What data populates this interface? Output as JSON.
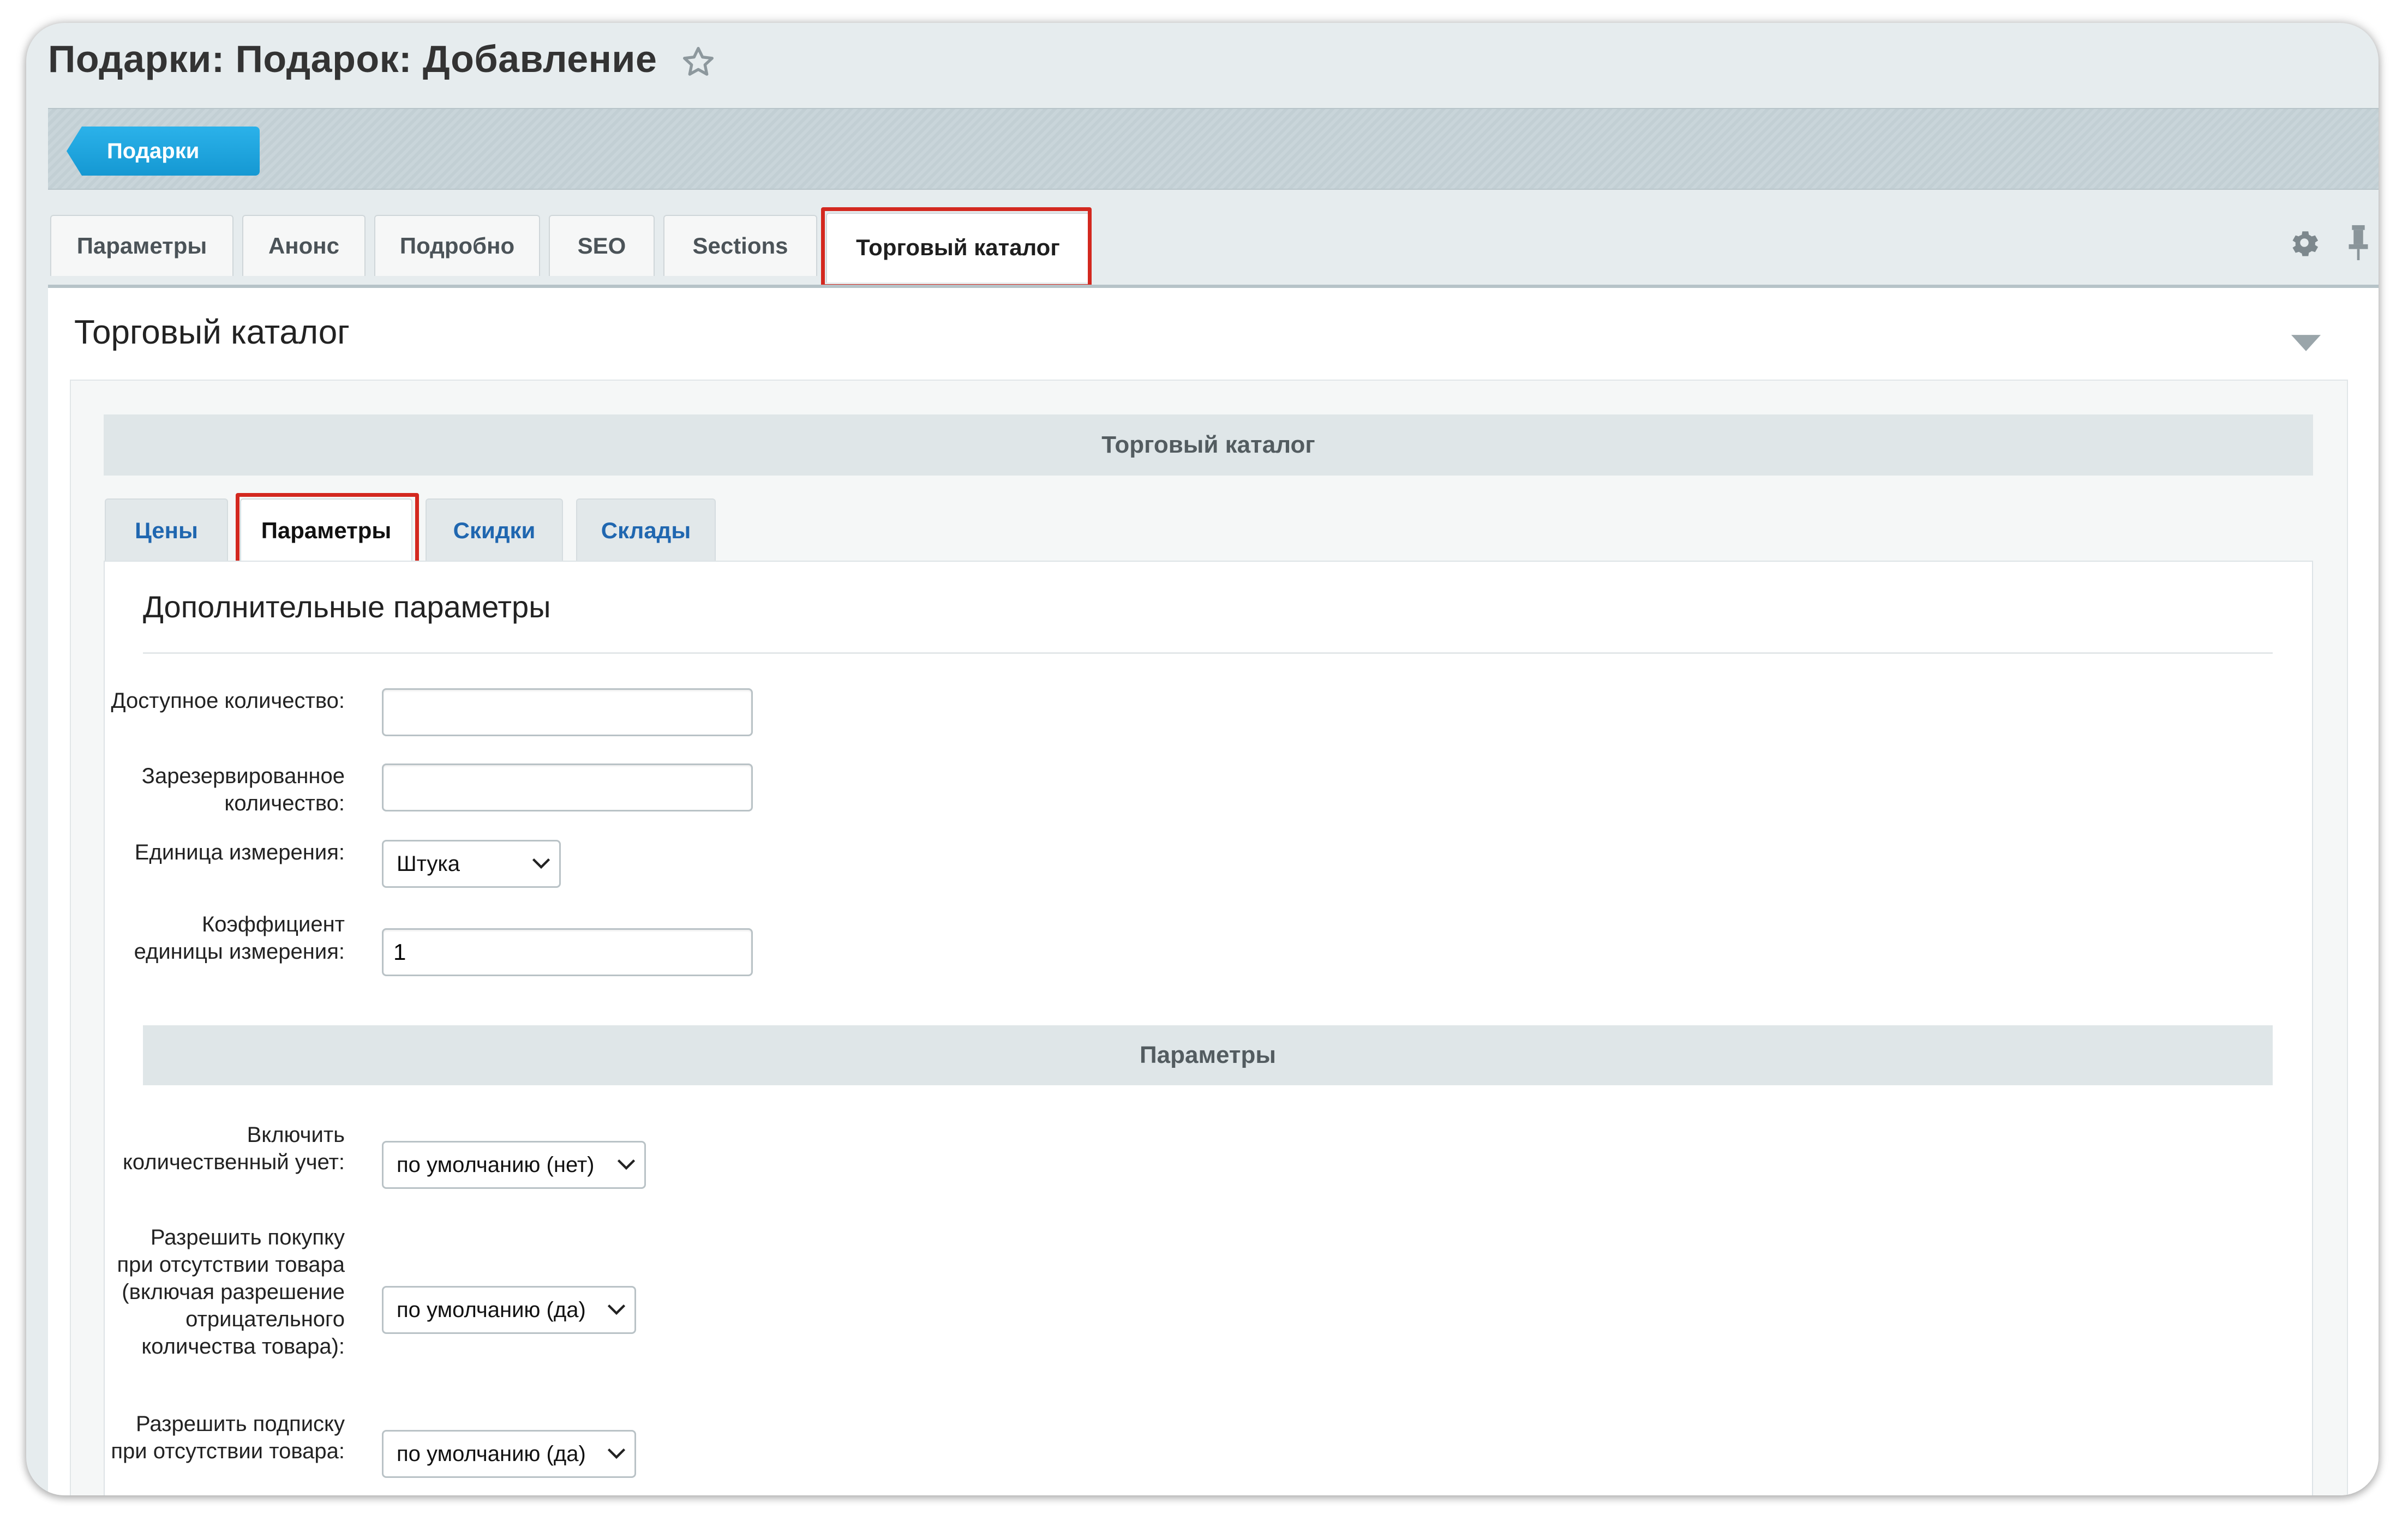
{
  "page_title": "Подарки: Подарок: Добавление",
  "toolbar": {
    "back_label": "Подарки"
  },
  "tabs": [
    {
      "label": "Параметры"
    },
    {
      "label": "Анонс"
    },
    {
      "label": "Подробно"
    },
    {
      "label": "SEO"
    },
    {
      "label": "Sections"
    },
    {
      "label": "Торговый каталог",
      "active": true
    }
  ],
  "section": {
    "title": "Торговый каталог"
  },
  "catalog": {
    "band_title": "Торговый каталог",
    "sub_tabs": [
      {
        "label": "Цены"
      },
      {
        "label": "Параметры",
        "active": true
      },
      {
        "label": "Скидки"
      },
      {
        "label": "Склады"
      }
    ],
    "panel_title": "Дополнительные параметры",
    "fields": {
      "available_qty": {
        "label": "Доступное количество:",
        "value": ""
      },
      "reserved_qty": {
        "label": "Зарезервированное количество:",
        "value": ""
      },
      "unit": {
        "label": "Единица измерения:",
        "value": "Штука"
      },
      "ratio": {
        "label": "Коэффициент единицы измерения:",
        "value": "1"
      }
    },
    "params_band": "Параметры",
    "params": {
      "quantity_trace": {
        "label": "Включить количественный учет:",
        "value": "по умолчанию (нет)"
      },
      "can_buy_zero": {
        "label": "Разрешить покупку при отсутствии товара (включая разрешение отрицательного количества товара):",
        "value": "по умолчанию (да)"
      },
      "subscribe": {
        "label": "Разрешить подписку при отсутствии товара:",
        "value": "по умолчанию (да)"
      }
    }
  },
  "colors": {
    "accent": "#1ea3dd",
    "highlight": "#d3281f",
    "link": "#2067b0"
  }
}
